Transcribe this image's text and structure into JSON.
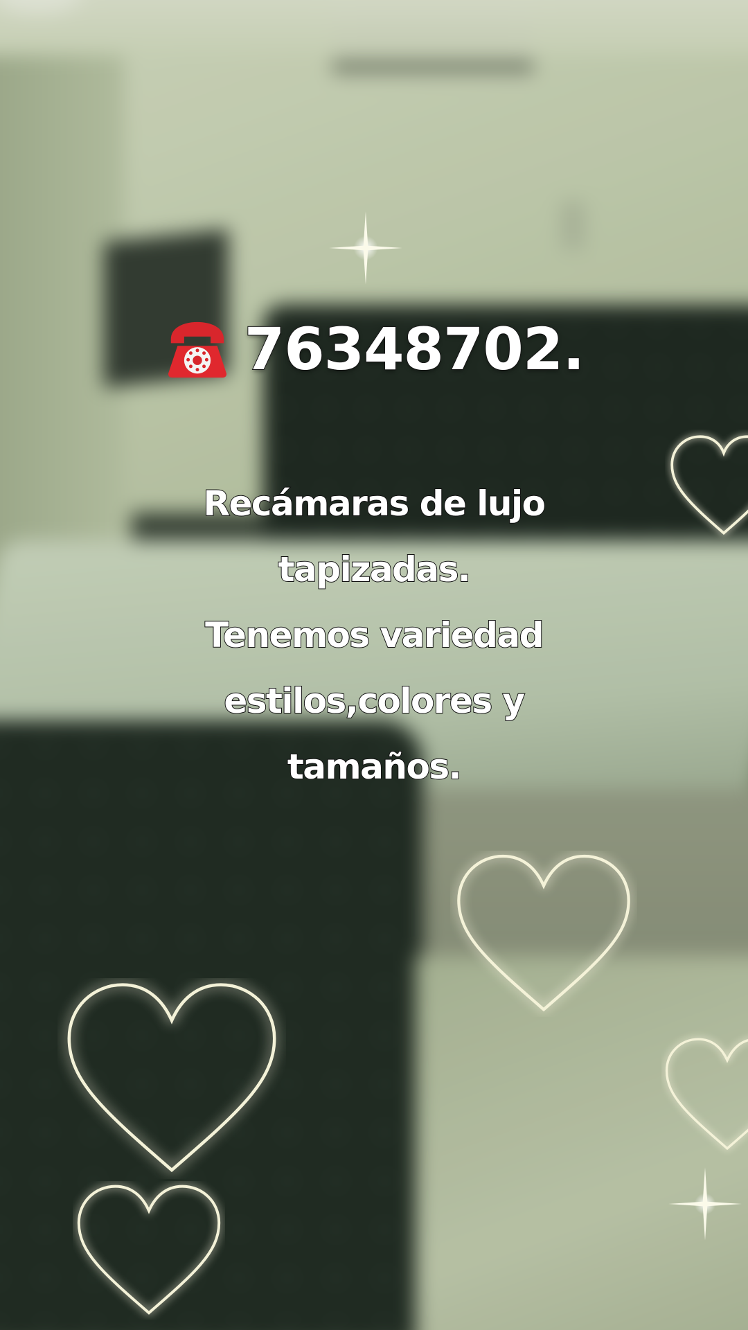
{
  "overlay": {
    "phone_icon": "telephone-icon",
    "phone_number": "76348702.",
    "caption_lines": [
      "Recámaras de lujo",
      "tapizadas.",
      "Tenemos variedad",
      "estilos,colores y",
      "tamaños."
    ]
  },
  "decorations": {
    "sparkle_icon": "sparkle-icon",
    "heart_icon": "heart-outline-icon",
    "sticker_color": "#f4f2d8",
    "heart_glow": "#fffbe6"
  },
  "background": {
    "description_icon": "blurred-bedroom-photo",
    "tint": "#c9d4b4"
  }
}
